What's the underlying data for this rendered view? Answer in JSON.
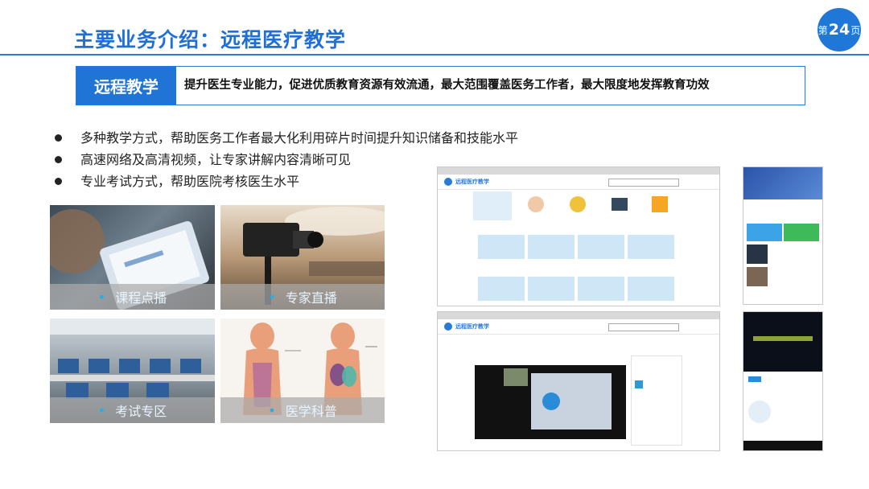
{
  "slide": {
    "title": "主要业务介绍：远程医疗教学",
    "page_prefix": "第",
    "page_number": "24",
    "page_suffix": "页"
  },
  "banner": {
    "tag": "远程教学",
    "text": "提升医生专业能力，促进优质教育资源有效流通，最大范围覆盖医务工作者，最大限度地发挥教育功效"
  },
  "bullets": [
    "多种教学方式，帮助医务工作者最大化利用碎片时间提升知识储备和技能水平",
    "高速网络及高清视频，让专家讲解内容清晰可见",
    "专业考试方式，帮助医院考核医生水平"
  ],
  "photos": [
    {
      "caption": "课程点播"
    },
    {
      "caption": "专家直播"
    },
    {
      "caption": "考试专区"
    },
    {
      "caption": "医学科普"
    }
  ],
  "screens": {
    "app_name": "远程医疗教学"
  },
  "colors": {
    "accent": "#1f74d6",
    "caption_bar": "#aaaaaa"
  }
}
